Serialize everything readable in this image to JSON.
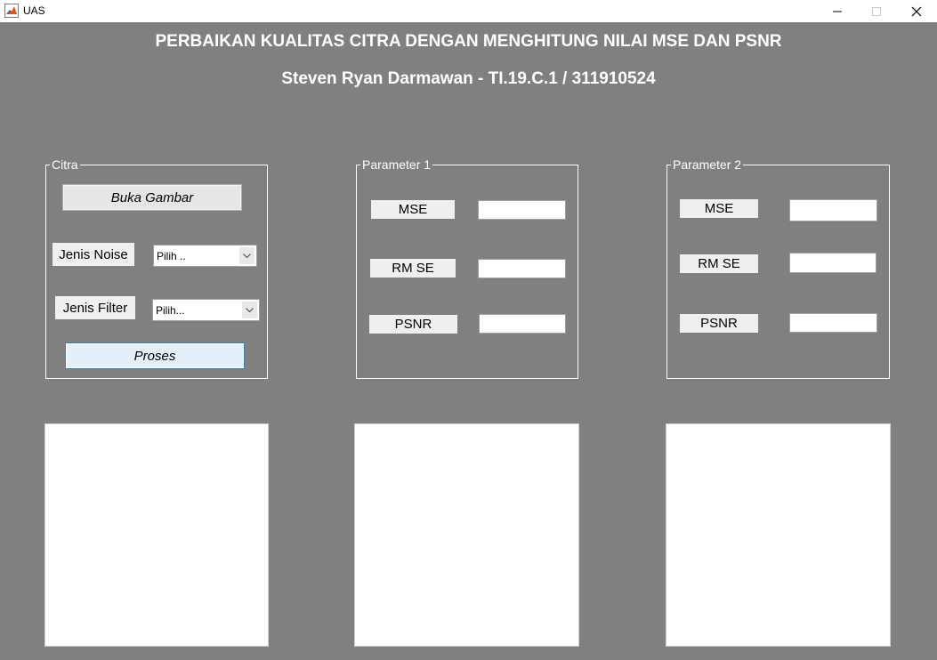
{
  "window": {
    "title": "UAS",
    "icon": "matlab-icon",
    "controls": [
      "minimize-icon",
      "maximize-icon",
      "close-icon"
    ]
  },
  "header": {
    "title": "PERBAIKAN KUALITAS CITRA DENGAN MENGHITUNG NILAI MSE DAN PSNR",
    "subtitle": "Steven Ryan Darmawan - TI.19.C.1 / 311910524"
  },
  "citra_panel": {
    "legend": "Citra",
    "open_button": "Buka Gambar",
    "noise_label": "Jenis Noise",
    "noise_select": "Pilih ..",
    "filter_label": "Jenis Filter",
    "filter_select": "Pilih...",
    "process_button": "Proses"
  },
  "parameter1": {
    "legend": "Parameter 1",
    "mse_label": "MSE",
    "mse_value": "",
    "rmse_label": "RM SE",
    "rmse_value": "",
    "psnr_label": "PSNR",
    "psnr_value": ""
  },
  "parameter2": {
    "legend": "Parameter 2",
    "mse_label": "MSE",
    "mse_value": "",
    "rmse_label": "RM SE",
    "rmse_value": "",
    "psnr_label": "PSNR",
    "psnr_value": ""
  },
  "colors": {
    "background": "#808080",
    "panel_border": "#ffffff",
    "process_accent": "#3c7fb1"
  }
}
